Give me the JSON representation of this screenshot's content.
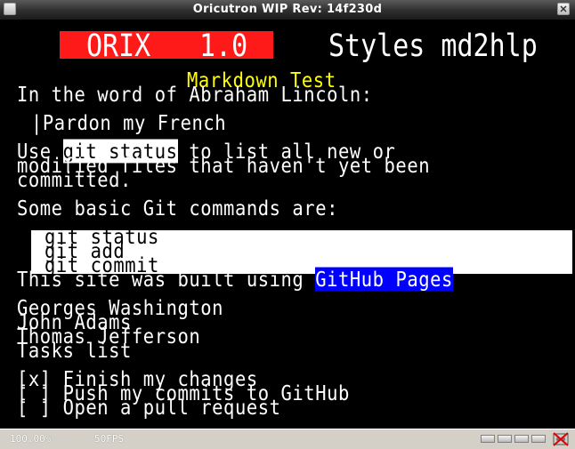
{
  "window": {
    "title": "Oricutron WIP Rev: 14f230d"
  },
  "screen": {
    "banner": {
      "red_left": "ORIX",
      "red_right": "1.0",
      "right_text": "Styles md2hlp"
    },
    "lines": {
      "heading": "Markdown Test",
      "lincoln": "In the word of Abraham Lincoln:",
      "quote": "|Pardon my French",
      "use_prefix": "Use ",
      "use_code": "git status",
      "use_suffix": " to list all new or",
      "modified": "modified files that haven't yet been",
      "committed": "committed.",
      "commands_intro": "Some basic Git commands are:",
      "code_lines": [
        "git status",
        "git add",
        "git commit"
      ],
      "built_prefix": "This site was built using ",
      "built_link": "GitHub Pages",
      "presidents": [
        "Georges Washington",
        "John Adams",
        "Thomas Jefferson"
      ],
      "tasks_heading": "Tasks list",
      "tasks": [
        "[x] Finish my changes",
        "[ ] Push my commits to GitHub",
        "[ ] Open a pull request"
      ]
    },
    "colors": {
      "background": "#000000",
      "text": "#ffffff",
      "heading": "#ffff00",
      "banner_red": "#ff1a1a",
      "link_bg": "#0000ff",
      "code_bg": "#ffffff"
    }
  },
  "statusbar": {
    "zoom": "100.00% -",
    "fps": "50FPS",
    "icons": [
      "drive-led-icon",
      "drive-led-icon",
      "drive-led-icon",
      "drive-led-icon",
      "tape-icon"
    ]
  }
}
